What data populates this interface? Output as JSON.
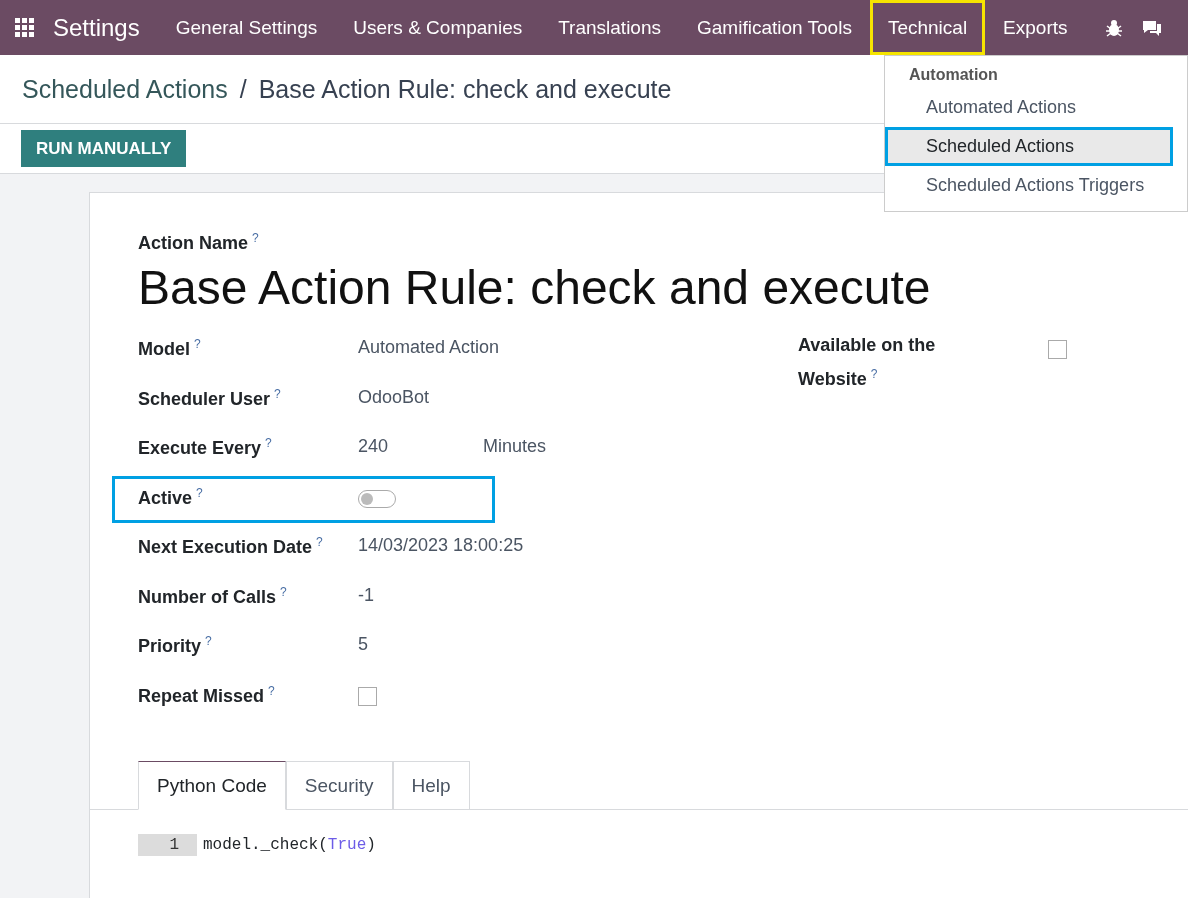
{
  "navbar": {
    "app_title": "Settings",
    "menu": [
      {
        "label": "General Settings",
        "highlighted": false
      },
      {
        "label": "Users & Companies",
        "highlighted": false
      },
      {
        "label": "Translations",
        "highlighted": false
      },
      {
        "label": "Gamification Tools",
        "highlighted": false
      },
      {
        "label": "Technical",
        "highlighted": true
      },
      {
        "label": "Exports",
        "highlighted": false
      }
    ]
  },
  "dropdown": {
    "section": "Automation",
    "items": [
      {
        "label": "Automated Actions",
        "selected": false,
        "highlighted": false
      },
      {
        "label": "Scheduled Actions",
        "selected": true,
        "highlighted": true
      },
      {
        "label": "Scheduled Actions Triggers",
        "selected": false,
        "highlighted": false
      }
    ]
  },
  "breadcrumb": {
    "parent": "Scheduled Actions",
    "separator": "/",
    "current": "Base Action Rule: check and execute"
  },
  "run_button": "RUN MANUALLY",
  "form": {
    "name_label": "Action Name",
    "name_help": "?",
    "name": "Base Action Rule: check and execute",
    "fields": [
      {
        "kind": "text",
        "label": "Model",
        "help": "?",
        "value": "Automated Action",
        "highlighted": false
      },
      {
        "kind": "text",
        "label": "Scheduler User",
        "help": "?",
        "value": "OdooBot",
        "highlighted": false
      },
      {
        "kind": "interval",
        "label": "Execute Every",
        "help": "?",
        "value": "240",
        "unit": "Minutes",
        "highlighted": false
      },
      {
        "kind": "toggle",
        "label": "Active",
        "help": "?",
        "on": false,
        "highlighted": true
      },
      {
        "kind": "text",
        "label": "Next Execution Date",
        "help": "?",
        "value": "14/03/2023 18:00:25",
        "highlighted": false
      },
      {
        "kind": "text",
        "label": "Number of Calls",
        "help": "?",
        "value": "-1",
        "highlighted": false
      },
      {
        "kind": "text",
        "label": "Priority",
        "help": "?",
        "value": "5",
        "highlighted": false
      },
      {
        "kind": "checkbox",
        "label": "Repeat Missed",
        "help": "?",
        "checked": false,
        "highlighted": false
      }
    ],
    "side_fields": [
      {
        "kind": "checkbox",
        "label": "Available on the Website",
        "help": "?",
        "checked": false,
        "highlighted": false
      }
    ]
  },
  "tabs": [
    {
      "label": "Python Code",
      "selected": true
    },
    {
      "label": "Security",
      "selected": false
    },
    {
      "label": "Help",
      "selected": false
    }
  ],
  "code": {
    "lines": [
      {
        "number": "1",
        "tokens": [
          {
            "kind": "plain",
            "text": "model._check("
          },
          {
            "kind": "keyword",
            "text": "True"
          },
          {
            "kind": "plain",
            "text": ")"
          }
        ]
      }
    ]
  }
}
